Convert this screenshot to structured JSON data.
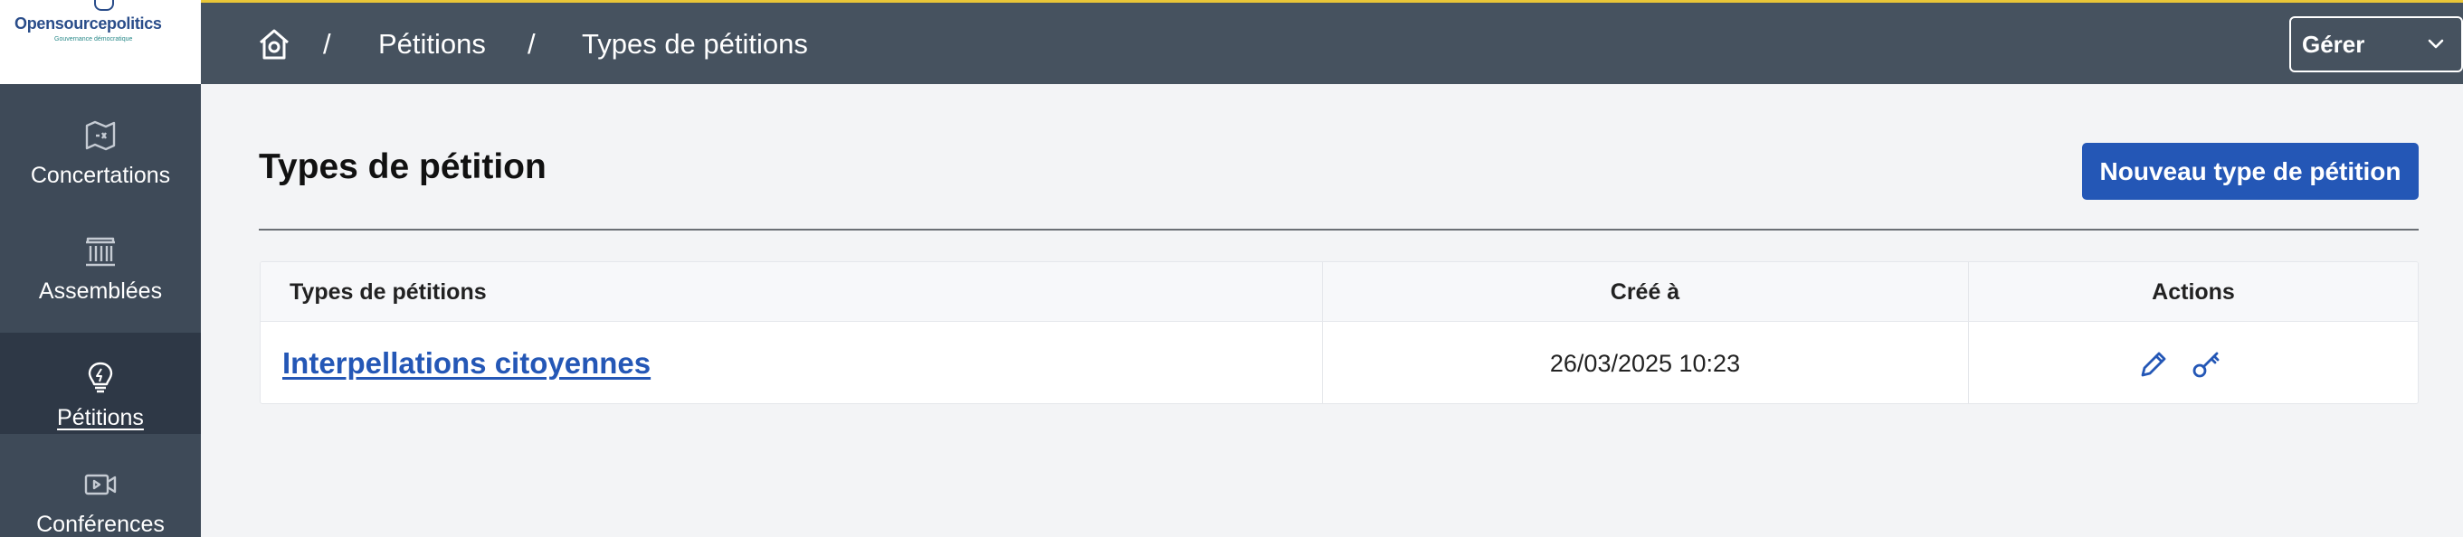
{
  "sidebar": {
    "logo_text": "Opensourcepolitics",
    "logo_tagline": "Gouvernance démocratique",
    "items": [
      {
        "label": "Concertations",
        "icon": "map-icon"
      },
      {
        "label": "Assemblées",
        "icon": "institution-icon"
      },
      {
        "label": "Pétitions",
        "icon": "lightbulb-icon",
        "active": true
      },
      {
        "label": "Conférences",
        "icon": "video-icon"
      }
    ]
  },
  "topbar": {
    "home_icon": "home-icon",
    "breadcrumb": [
      "Pétitions",
      "Types de pétitions"
    ],
    "separator": "/",
    "manage_label": "Gérer"
  },
  "main": {
    "title": "Types de pétition",
    "new_button_label": "Nouveau type de pétition",
    "table": {
      "headers": [
        "Types de pétitions",
        "Créé à",
        "Actions"
      ],
      "rows": [
        {
          "name": "Interpellations citoyennes",
          "created_at": "26/03/2025 10:23",
          "actions": [
            "pencil-icon",
            "key-icon"
          ]
        }
      ]
    }
  },
  "colors": {
    "sidebar": "#3e4a58",
    "topbar": "#46525f",
    "accent_line": "#e9c637",
    "primary": "#2457b6"
  }
}
